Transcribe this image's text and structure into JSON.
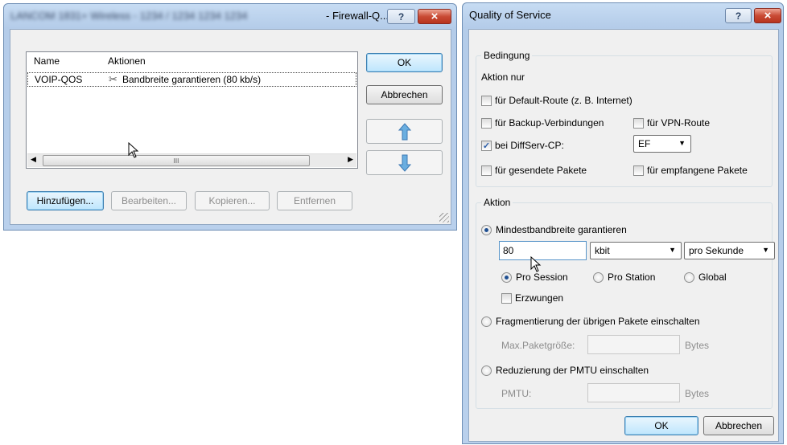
{
  "firewall": {
    "title_prefix": "LANCOM 1831+ Wireless - 1234 / 1234 1234 1234",
    "title_suffix": "- Firewall-Q...",
    "help_label": "?",
    "close_label": "×",
    "columns": [
      "Name",
      "Aktionen"
    ],
    "row": {
      "name": "VOIP-QOS",
      "action": "Bandbreite garantieren (80 kb/s)"
    },
    "scroll_mark": "III",
    "buttons": {
      "ok": "OK",
      "cancel": "Abbrechen",
      "add": "Hinzufügen...",
      "edit": "Bearbeiten...",
      "copy": "Kopieren...",
      "remove": "Entfernen"
    }
  },
  "qos": {
    "title": "Quality of Service",
    "help_label": "?",
    "close_label": "×",
    "condition": {
      "legend": "Bedingung",
      "action_only": "Aktion nur",
      "default_route": "für Default-Route (z. B. Internet)",
      "backup": "für Backup-Verbindungen",
      "vpn": "für VPN-Route",
      "diffserv": "bei DiffServ-CP:",
      "diffserv_value": "EF",
      "sent": "für gesendete Pakete",
      "received": "für empfangene Pakete"
    },
    "action": {
      "legend": "Aktion",
      "min_bandwidth": "Mindestbandbreite garantieren",
      "bandwidth_value": "80",
      "unit": "kbit",
      "per": "pro Sekunde",
      "pro_session": "Pro Session",
      "pro_station": "Pro Station",
      "global": "Global",
      "enforce": "Erzwungen",
      "fragment": "Fragmentierung der übrigen Pakete einschalten",
      "max_packet": "Max.Paketgröße:",
      "bytes1": "Bytes",
      "pmtu_reduce": "Reduzierung der PMTU einschalten",
      "pmtu": "PMTU:",
      "bytes2": "Bytes"
    },
    "buttons": {
      "ok": "OK",
      "cancel": "Abbrechen"
    }
  }
}
